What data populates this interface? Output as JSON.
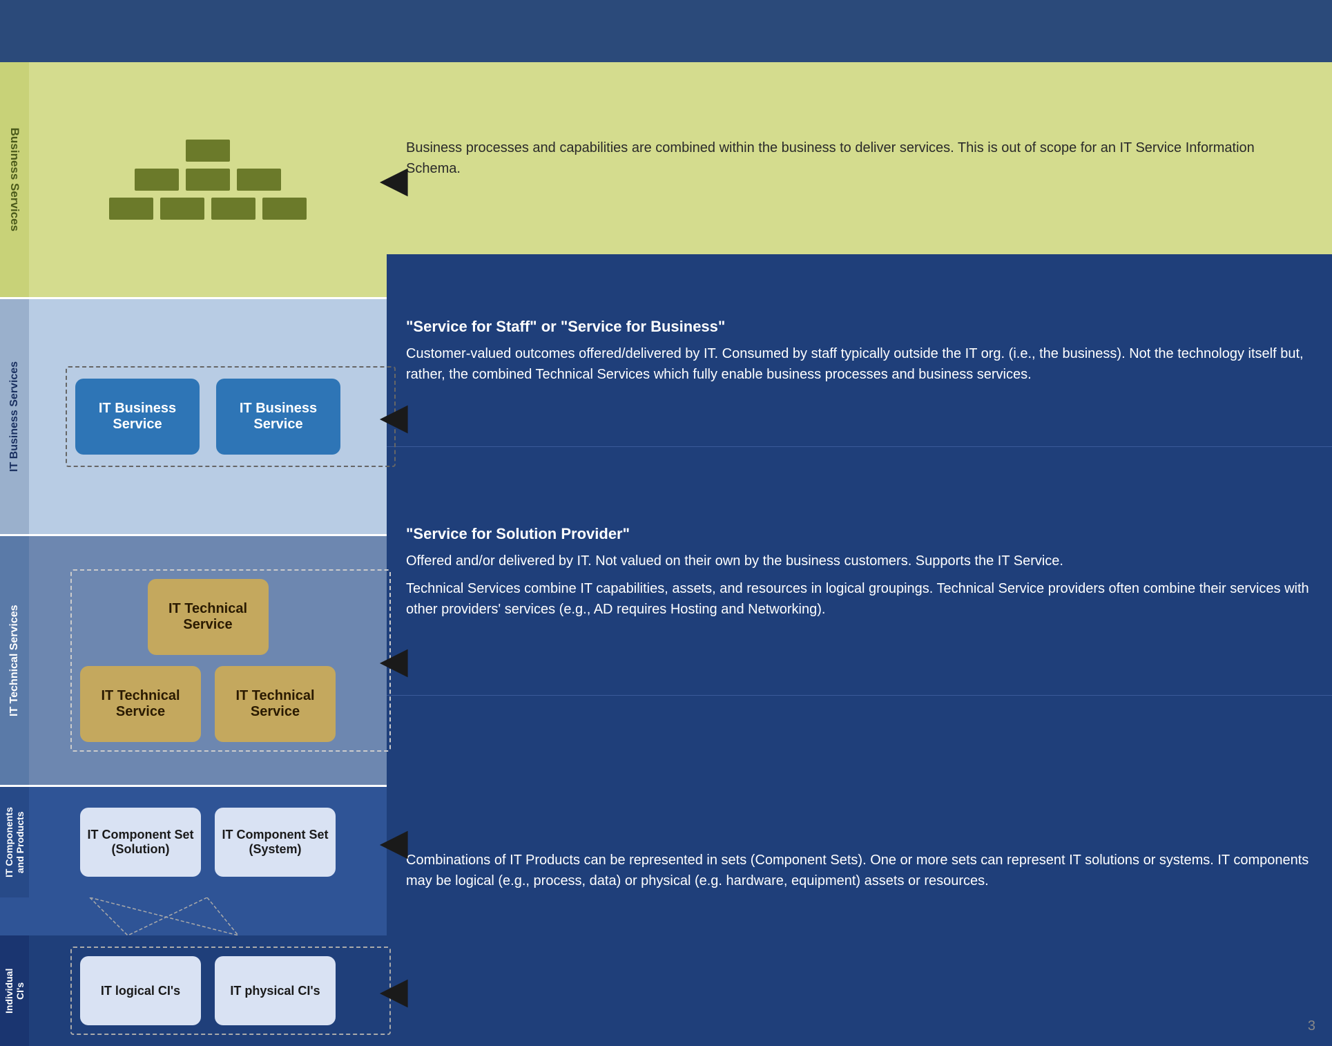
{
  "topBar": {},
  "sections": {
    "business": {
      "label": "Business\nServices",
      "description": "Business processes and capabilities are combined within the business to deliver services. This is out of scope for an IT Service Information Schema."
    },
    "itBusiness": {
      "label": "IT Business Services",
      "box1": "IT Business\nService",
      "box2": "IT Business\nService",
      "title": "\"Service for Staff\" or \"Service for Business\"",
      "description": "Customer-valued outcomes offered/delivered by IT.  Consumed by staff typically outside the IT org. (i.e., the business).  Not the technology itself but, rather, the combined Technical Services which fully enable business processes and business services."
    },
    "itTechnical": {
      "label": "IT Technical Services",
      "box1": "IT Technical\nService",
      "box2": "IT Technical\nService",
      "box3": "IT Technical\nService",
      "title": "\"Service for Solution Provider\"",
      "description1": "Offered and/or delivered by IT.  Not valued on their own by the business customers. Supports the IT Service.",
      "description2": "Technical Services combine IT capabilities, assets, and resources in logical groupings. Technical Service providers often combine their services with other providers' services (e.g., AD requires Hosting and Networking)."
    },
    "itComponents": {
      "label": "IT Components\nand Products",
      "box1": "IT Component\nSet (Solution)",
      "box2": "IT Component\nSet (System)",
      "description": "Combinations of IT Products can be represented in sets (Component Sets). One or more sets can represent IT solutions or systems. IT components may be logical (e.g., process, data) or physical (e.g. hardware, equipment) assets or resources."
    },
    "individualCIs": {
      "label": "Individual\nCI's",
      "box1": "IT logical CI's",
      "box2": "IT physical\nCI's"
    }
  },
  "pageNumber": "3"
}
